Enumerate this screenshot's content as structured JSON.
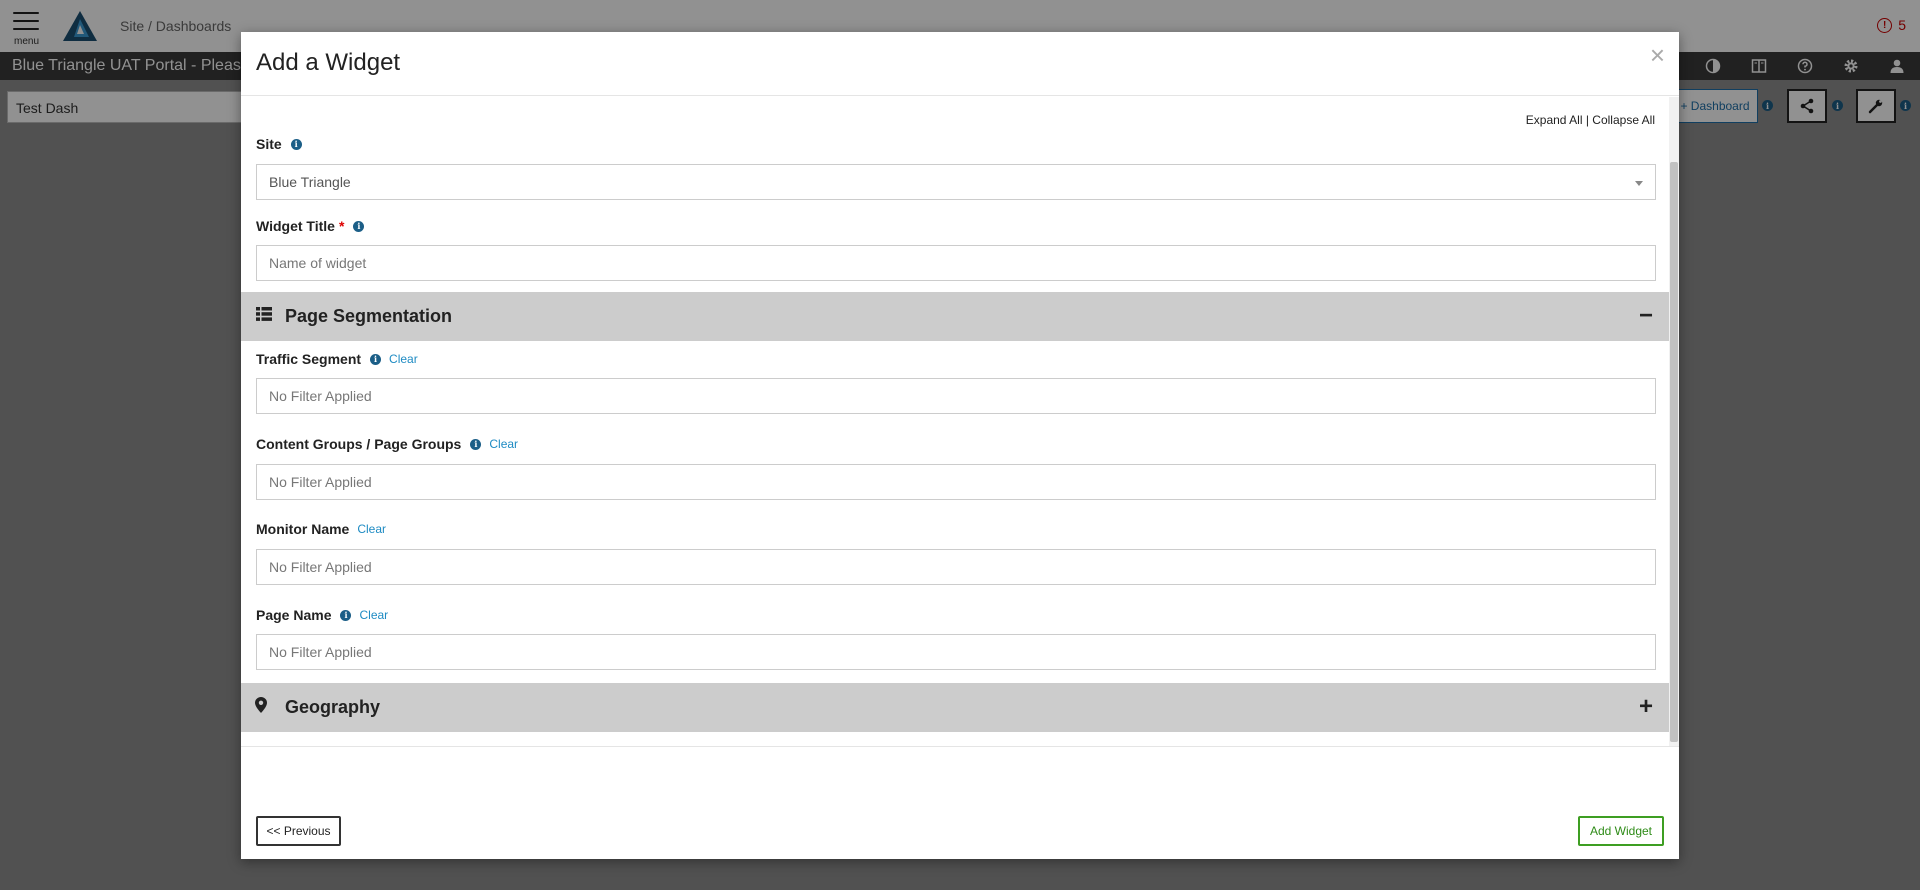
{
  "app": {
    "menu_label": "menu",
    "breadcrumb": "Site / Dashboards",
    "alert_count": "5",
    "portal_title": "Blue Triangle UAT Portal - Please",
    "dashboard_select_value": "Test Dash",
    "add_dashboard_label": "+ Dashboard"
  },
  "modal": {
    "title": "Add a Widget",
    "close_label": "×",
    "expand_all": "Expand All",
    "separator": " | ",
    "collapse_all": "Collapse All",
    "site": {
      "label": "Site",
      "value": "Blue Triangle"
    },
    "widget_title": {
      "label": "Widget Title",
      "required_mark": "*",
      "placeholder": "Name of widget"
    },
    "sections": {
      "page_segmentation": {
        "title": "Page Segmentation",
        "toggle": "−"
      },
      "geography": {
        "title": "Geography",
        "toggle": "+"
      }
    },
    "filters": {
      "clear_label": "Clear",
      "traffic_segment": {
        "label": "Traffic Segment",
        "value": "No Filter Applied"
      },
      "content_groups": {
        "label": "Content Groups / Page Groups",
        "value": "No Filter Applied"
      },
      "monitor_name": {
        "label": "Monitor Name",
        "value": "No Filter Applied"
      },
      "page_name": {
        "label": "Page Name",
        "value": "No Filter Applied"
      }
    },
    "footer": {
      "previous_label": "<< Previous",
      "add_widget_label": "Add Widget"
    }
  }
}
